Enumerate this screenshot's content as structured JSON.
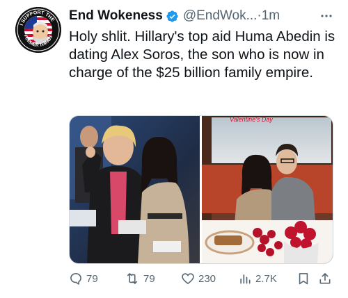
{
  "author": {
    "display_name": "End Wokeness",
    "handle": "@EndWok...",
    "separator": "·",
    "time": "1m",
    "avatar_icon": "i-support-former-things-badge-icon",
    "avatar_text_top": "I SUPPORT THE",
    "avatar_text_bottom": "FORMER THINGS",
    "verified_color": "#1d9bf0"
  },
  "tweet": {
    "text": "Holy shlit. Hillary's top aid Huma Abedin is dating Alex Soros, the son who is now in charge of the $25 billion family empire."
  },
  "media": {
    "left_photo": "two-women-at-event-photo",
    "right_photo": "couple-with-roses-photo",
    "right_photo_sign": "Valentine's Day"
  },
  "actions": {
    "replies": "79",
    "reposts": "79",
    "likes": "230",
    "views": "2.7K"
  },
  "colors": {
    "text": "#0f1419",
    "secondary": "#536471",
    "border": "#cfd9de"
  }
}
